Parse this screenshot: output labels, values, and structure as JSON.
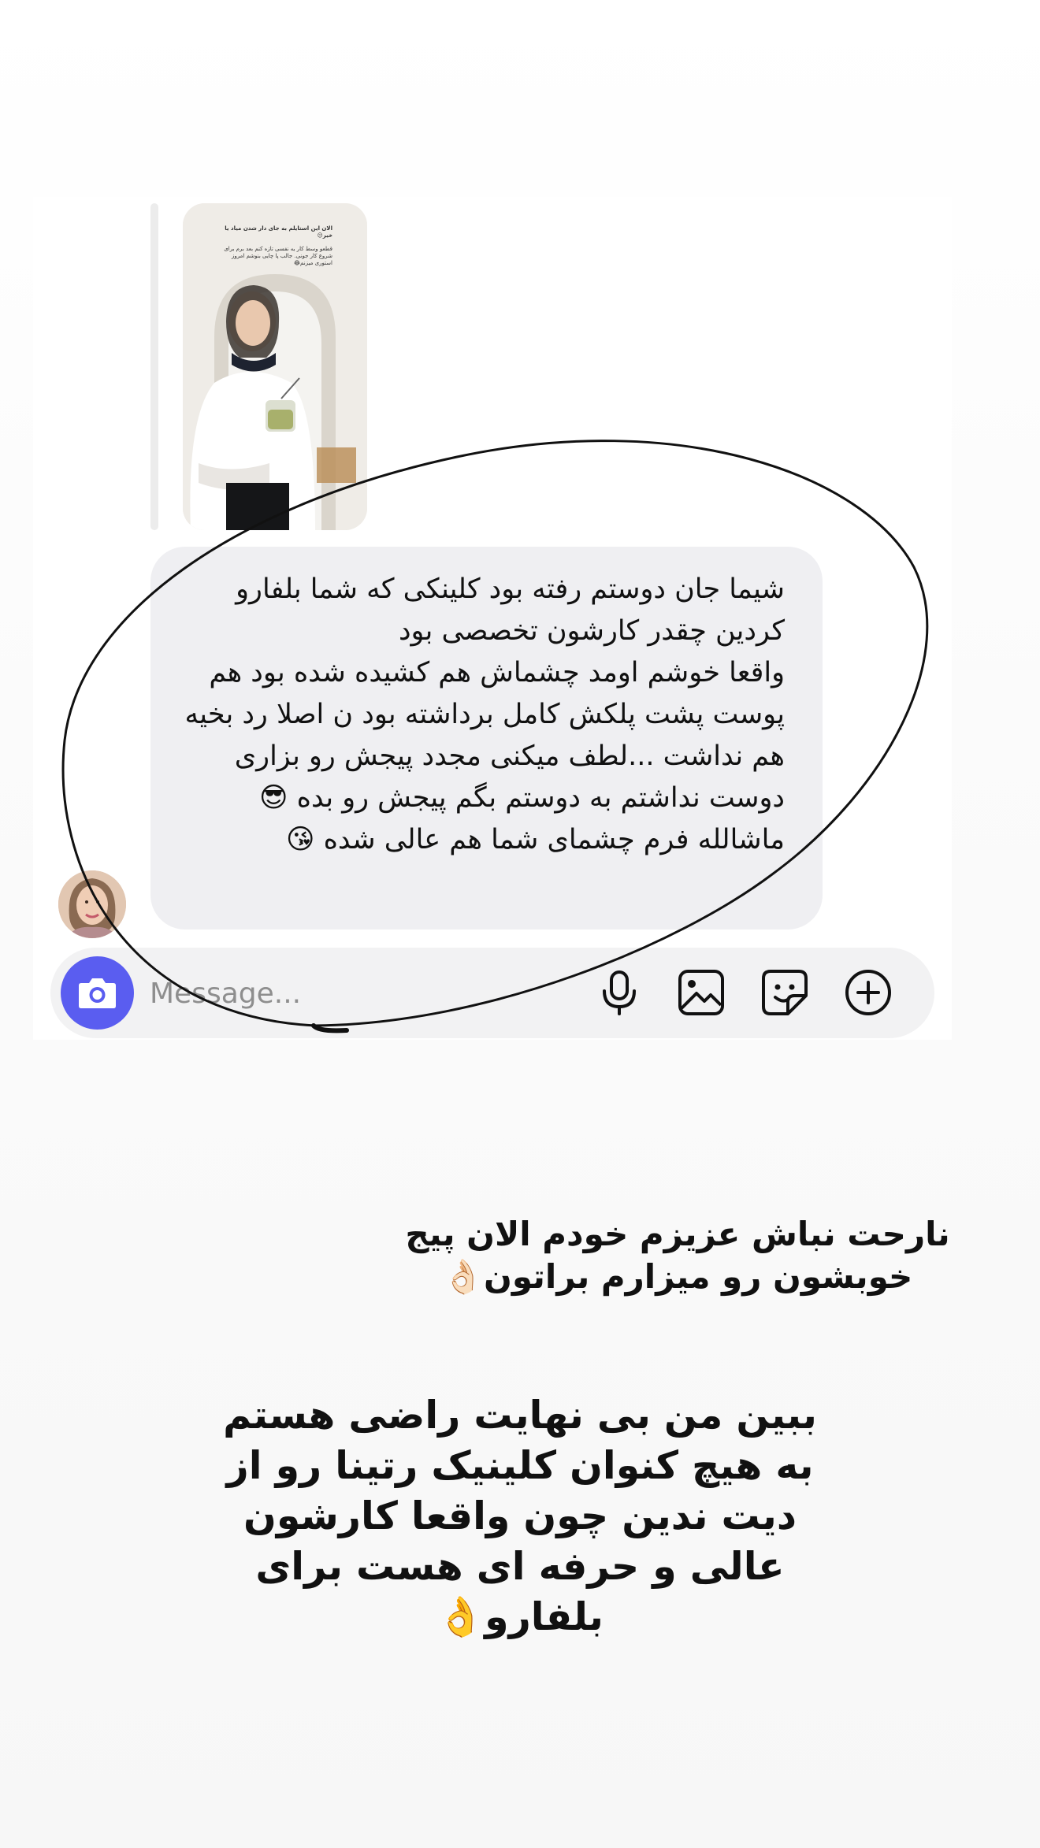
{
  "story_reply": {
    "thumb_caption_top": "الان این استایلم به جای دار شدن میاد یا خیر😕",
    "thumb_caption_body": "قطعو وسط کار یه نفسی تازه کنم بعد برم برای شروع کار جونی. جالب پا چایی بنوشم امروز استوری میزنم😂"
  },
  "message": {
    "paragraphs": [
      "شیما جان دوستم رفته بود کلینکی که شما بلفارو کردین چقدر کارشون تخصصی بود",
      "واقعا خوشم اومد چشماش هم کشیده شده بود هم پوست پشت پلکش کامل برداشته بود ن اصلا رد بخیه هم نداشت ...لطف میکنی مجدد پیجش رو بزاری دوست نداشتم به دوستم بگم پیجش رو بده 😎",
      "ماشالله فرم چشمای شما هم عالی شده 😘"
    ]
  },
  "composer": {
    "placeholder": "Message..."
  },
  "overlay": {
    "reply_text": "نارحت نباش عزیزم خودم الان پیج\nخوبشون رو میزارم براتون👌🏻",
    "main_text": "ببین من بی نهایت راضی هستم\nبه هیچ کنوان کلینیک رتینا رو از\nدیت ندین چون واقعا کارشون\nعالی و حرفه ای هست برای\nبلفارو👌"
  },
  "colors": {
    "camera_button": "#5a5df0",
    "bubble": "#efeff2",
    "composer": "#f2f2f3"
  },
  "icons": {
    "camera": "camera-icon",
    "mic": "microphone-icon",
    "gallery": "gallery-icon",
    "sticker": "sticker-icon",
    "add": "plus-circle-icon"
  }
}
